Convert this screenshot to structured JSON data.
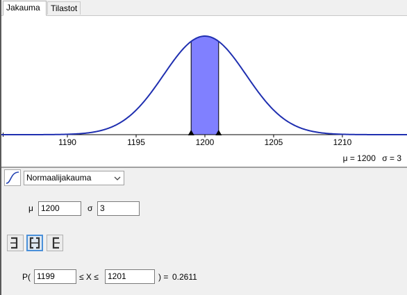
{
  "tabs": [
    {
      "label": "Jakauma",
      "active": true
    },
    {
      "label": "Tilastot",
      "active": false
    }
  ],
  "chart_data": {
    "type": "area",
    "distribution": "normal",
    "mu": 1200,
    "sigma": 3,
    "xlim": [
      1185.2,
      1214.7
    ],
    "x_ticks": [
      1190,
      1195,
      1200,
      1205,
      1210
    ],
    "x_tick_labels": [
      "1190",
      "1195",
      "1200",
      "1205",
      "1210"
    ],
    "shaded_interval": [
      1199,
      1201
    ],
    "curve_color": "#1f2fb0",
    "shade_color": "#8080ff"
  },
  "readout": {
    "mu_text": "μ = 1200",
    "sigma_text": "σ = 3"
  },
  "distribution_select": {
    "value": "Normaalijakauma",
    "icon": "cdf-curve-icon"
  },
  "params": {
    "mu_label": "μ",
    "mu_value": "1200",
    "sigma_label": "σ",
    "sigma_value": "3"
  },
  "interval_buttons": [
    {
      "name": "left-sided-button",
      "icon": "left-bracket-icon",
      "selected": false
    },
    {
      "name": "interval-button",
      "icon": "interval-brackets-icon",
      "selected": true
    },
    {
      "name": "right-sided-button",
      "icon": "right-bracket-icon",
      "selected": false
    }
  ],
  "probability": {
    "prefix": "P(",
    "low": "1199",
    "middle": "≤ X ≤",
    "high": "1201",
    "suffix": ") =",
    "result": "0.2611"
  }
}
